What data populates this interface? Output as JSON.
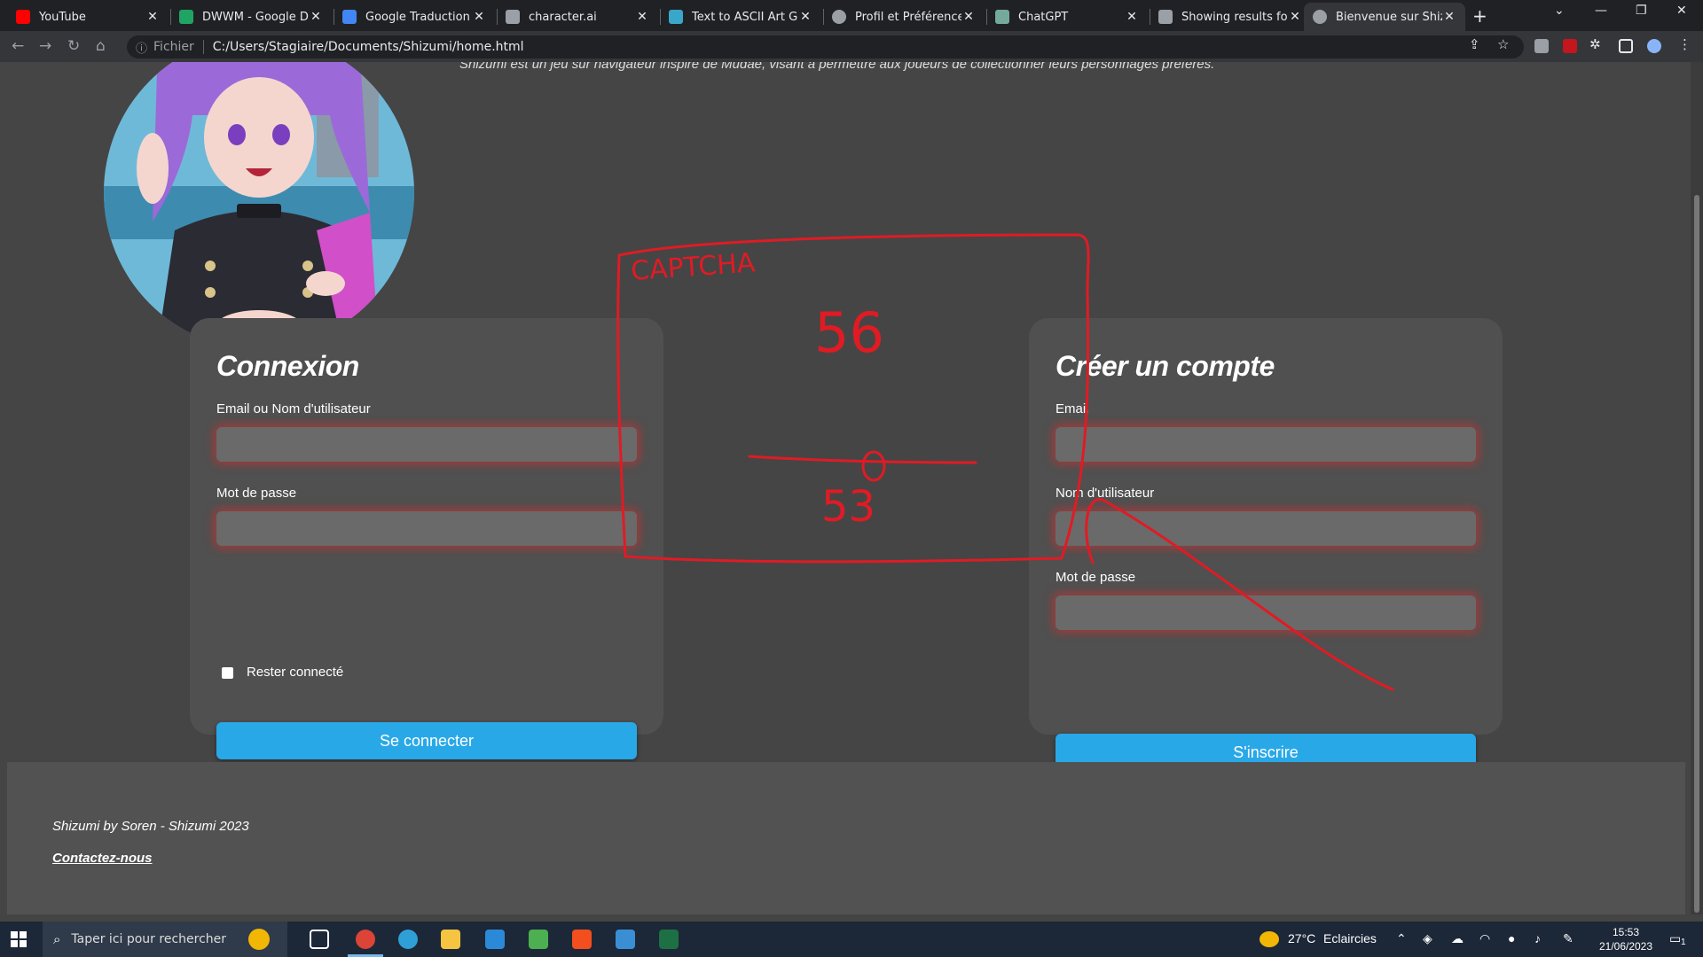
{
  "browser": {
    "tabs": [
      {
        "title": "YouTube",
        "favicon_color": "#ff0000"
      },
      {
        "title": "DWWM - Google Driv",
        "favicon_color": "#1fa463"
      },
      {
        "title": "Google Traduction",
        "favicon_color": "#4285f4"
      },
      {
        "title": "character.ai",
        "favicon_color": "#9aa0a6"
      },
      {
        "title": "Text to ASCII Art Gene",
        "favicon_color": "#3aa6c9"
      },
      {
        "title": "Profil et Préférences -",
        "favicon_color": "#9aa0a6"
      },
      {
        "title": "ChatGPT",
        "favicon_color": "#74aa9c"
      },
      {
        "title": "Showing results for up",
        "favicon_color": "#9aa0a6"
      },
      {
        "title": "Bienvenue sur Shizumi",
        "favicon_color": "#9aa0a6"
      }
    ],
    "active_tab_index": 8,
    "new_tab": "+",
    "address": {
      "scheme_label": "Fichier",
      "url": "C:/Users/Stagiaire/Documents/Shizumi/home.html"
    }
  },
  "page": {
    "intro_text": "Shizumi est un jeu sur navigateur inspiré de Mudae, visant à permettre aux joueurs de collectionner leurs personnages préférés.",
    "login": {
      "title": "Connexion",
      "user_label": "Email ou Nom d'utilisateur",
      "user_value": "",
      "password_label": "Mot de passe",
      "password_value": "",
      "remember_label": "Rester connecté",
      "remember_checked": false,
      "submit": "Se connecter"
    },
    "signup": {
      "title": "Créer un compte",
      "email_label": "Email",
      "email_value": "",
      "username_label": "Nom d'utilisateur",
      "username_value": "",
      "password_label": "Mot de passe",
      "password_value": "",
      "submit": "S'inscrire"
    },
    "annotation": {
      "label": "CAPTCHA",
      "number_top": "56",
      "number_bottom": "53",
      "ink_color": "#e01b24"
    },
    "footer": {
      "credit": "Shizumi by Soren - Shizumi 2023",
      "contact": "Contactez-nous"
    },
    "accent_color": "#29a8e8"
  },
  "taskbar": {
    "search_placeholder": "Taper ici pour rechercher",
    "weather": {
      "temp": "27°C",
      "condition": "Eclaircies"
    },
    "clock": {
      "time": "15:53",
      "date": "21/06/2023"
    },
    "notification_count": "1"
  }
}
